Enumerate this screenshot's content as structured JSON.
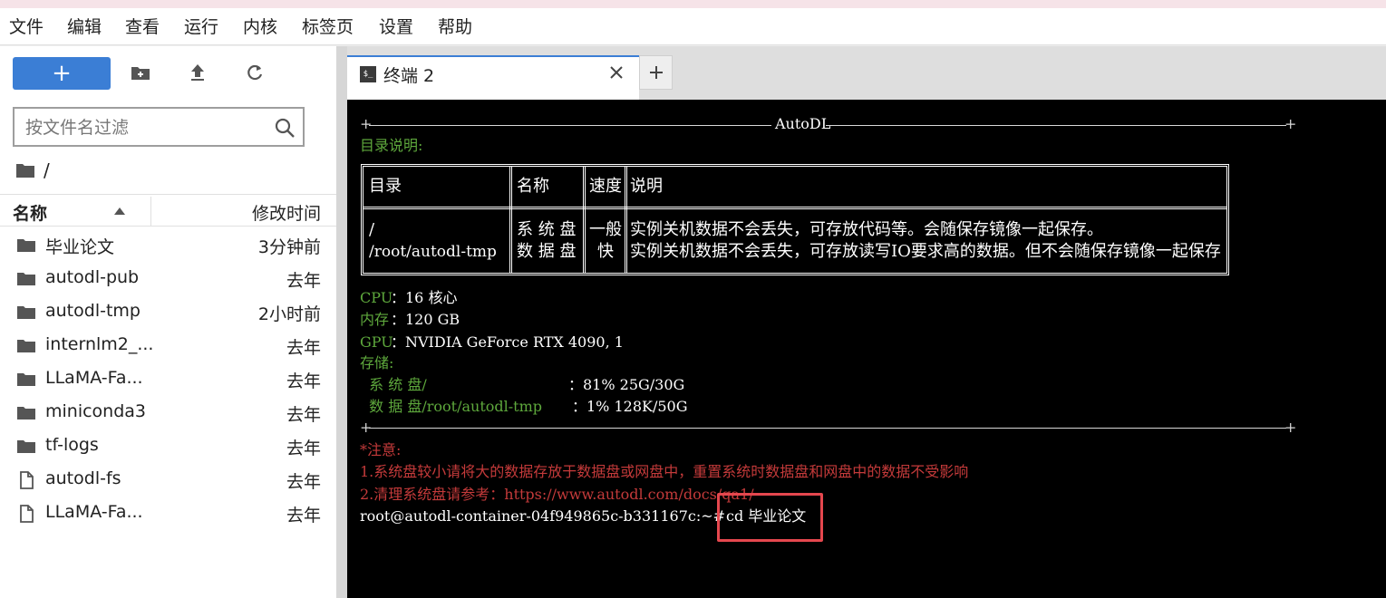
{
  "menubar": {
    "items": [
      "文件",
      "编辑",
      "查看",
      "运行",
      "内核",
      "标签页",
      "设置",
      "帮助"
    ]
  },
  "sidebar": {
    "new_button_label": "+",
    "filter_placeholder": "按文件名过滤",
    "breadcrumb": "/",
    "columns": {
      "name": "名称",
      "modified": "修改时间"
    },
    "files": [
      {
        "name": "毕业论文",
        "modified": "3分钟前",
        "type": "folder"
      },
      {
        "name": "autodl-pub",
        "modified": "去年",
        "type": "folder"
      },
      {
        "name": "autodl-tmp",
        "modified": "2小时前",
        "type": "folder"
      },
      {
        "name": "internlm2_...",
        "modified": "去年",
        "type": "folder"
      },
      {
        "name": "LLaMA-Fa...",
        "modified": "去年",
        "type": "folder"
      },
      {
        "name": "miniconda3",
        "modified": "去年",
        "type": "folder"
      },
      {
        "name": "tf-logs",
        "modified": "去年",
        "type": "folder"
      },
      {
        "name": "autodl-fs",
        "modified": "去年",
        "type": "file"
      },
      {
        "name": "LLaMA-Fa...",
        "modified": "去年",
        "type": "file"
      }
    ]
  },
  "tabs": {
    "active_label": "终端 2",
    "icon_text": "$_",
    "new_tab_label": "+"
  },
  "terminal": {
    "banner_title": "AutoDL",
    "dir_heading": "目录说明:",
    "table": {
      "headers": [
        "目录",
        "名称",
        "速度",
        "说明"
      ],
      "rows": [
        [
          "/",
          "系 统 盘",
          "一般",
          "实例关机数据不会丢失，可存放代码等。会随保存镜像一起保存。"
        ],
        [
          "/root/autodl-tmp",
          "数 据 盘",
          "快",
          "实例关机数据不会丢失，可存放读写IO要求高的数据。但不会随保存镜像一起保存"
        ]
      ]
    },
    "cpu_label": "CPU",
    "cpu_value": "：16 核心",
    "mem_label": "内存",
    "mem_value": "：120 GB",
    "gpu_label": "GPU",
    "gpu_value": "：NVIDIA GeForce RTX 4090, 1",
    "storage_label": "存储:",
    "sys_disk_label": "  系 统 盘/",
    "sys_disk_value": "：81% 25G/30G",
    "data_disk_label": "  数 据 盘/root/autodl-tmp",
    "data_disk_value": "：1% 128K/50G",
    "notice_title": "*注意:",
    "notice_1": "1.系统盘较小请将大的数据存放于数据盘或网盘中，重置系统时数据盘和网盘中的数据不受影响",
    "notice_2": "2.清理系统盘请参考：https://www.autodl.com/docs/qa1/",
    "prompt": "root@autodl-container-04f949865c-b331167c:~#",
    "command": "cd 毕业论文"
  },
  "colors": {
    "accent": "#3b7ed5",
    "terminal_bg": "#000000",
    "terminal_green": "#5ea83c",
    "terminal_red": "#c43a3a",
    "highlight": "#e5474e"
  }
}
